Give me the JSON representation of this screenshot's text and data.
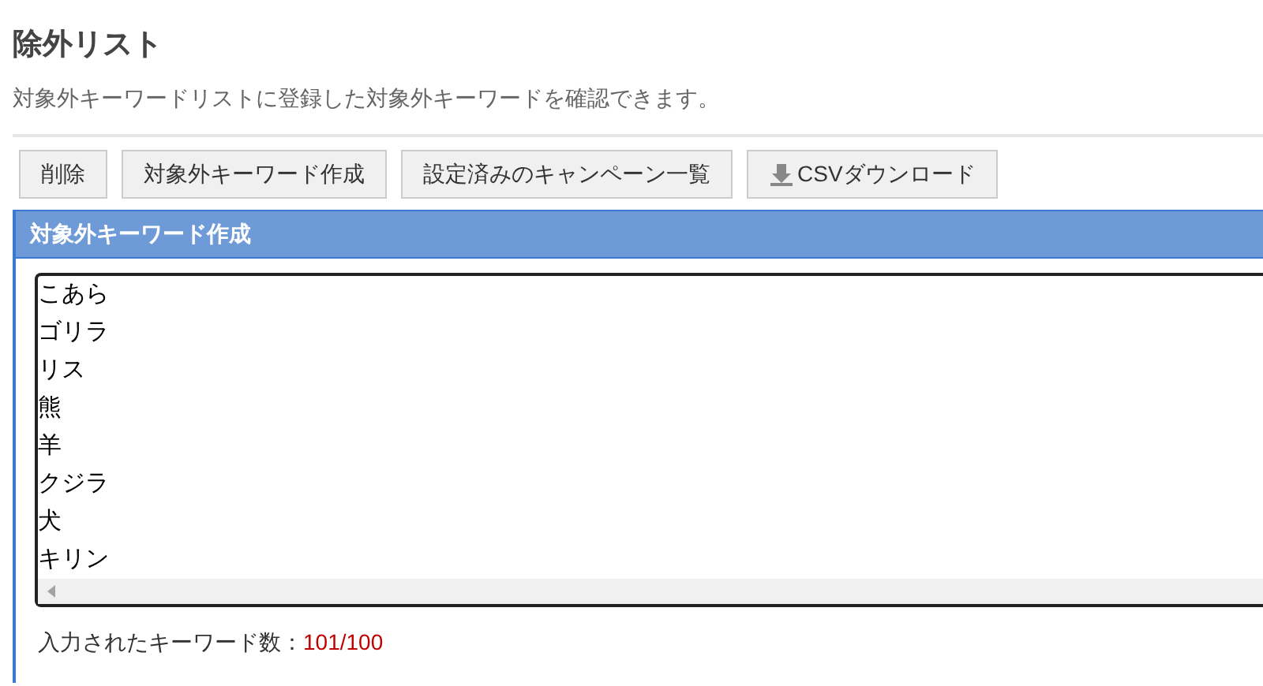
{
  "page": {
    "title": "除外リスト",
    "description": "対象外キーワードリストに登録した対象外キーワードを確認できます。"
  },
  "toolbar": [
    {
      "label": "削除",
      "kind": "plain"
    },
    {
      "label": "対象外キーワード作成",
      "kind": "plain"
    },
    {
      "label": "設定済みのキャンペーン一覧",
      "kind": "plain"
    },
    {
      "label": "CSVダウンロード",
      "kind": "download"
    }
  ],
  "panel": {
    "title": "対象外キーワード作成",
    "keywords": [
      "こあら",
      "ゴリラ",
      "リス",
      "熊",
      "羊",
      "クジラ",
      "犬",
      "キリン"
    ],
    "count_label": "入力されたキーワード数：",
    "count": "101/100",
    "over_limit": true
  }
}
